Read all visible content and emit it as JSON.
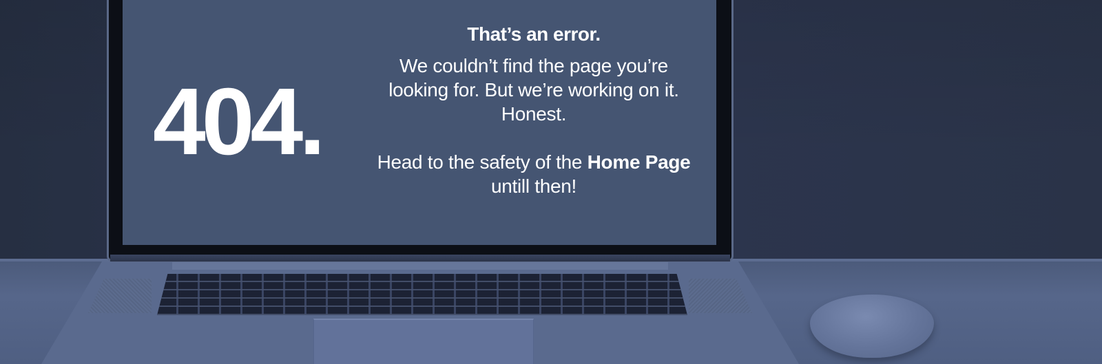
{
  "error": {
    "code": "404."
  },
  "message": {
    "title": "That’s an error.",
    "line1": "We couldn’t find the page you’re looking for. But we’re working on it. Honest.",
    "line2_prefix": "Head to the safety of the",
    "home_link_label": "Home Page",
    "line2_suffix": "untill then!"
  },
  "colors": {
    "screen_background": "#455572",
    "wall": "#2a3347",
    "text": "#ffffff"
  },
  "scene": {
    "objects": [
      "laptop-icon",
      "keyboard-icon",
      "trackpad-icon",
      "mouse-icon"
    ]
  }
}
